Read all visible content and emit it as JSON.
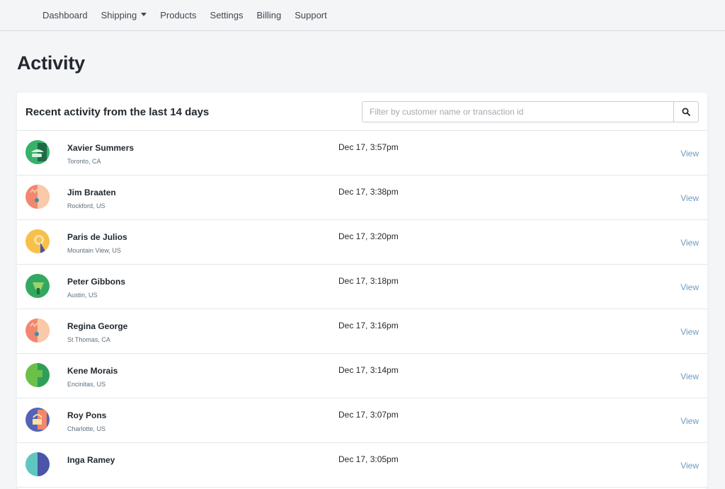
{
  "nav": {
    "items": [
      {
        "label": "Dashboard",
        "has_caret": false
      },
      {
        "label": "Shipping",
        "has_caret": true
      },
      {
        "label": "Products",
        "has_caret": false
      },
      {
        "label": "Settings",
        "has_caret": false
      },
      {
        "label": "Billing",
        "has_caret": false
      },
      {
        "label": "Support",
        "has_caret": false
      }
    ]
  },
  "page": {
    "title": "Activity"
  },
  "activity": {
    "heading": "Recent activity from the last 14 days",
    "search": {
      "placeholder": "Filter by customer name or transaction id",
      "value": "",
      "icon": "search-icon"
    },
    "view_label": "View",
    "rows": [
      {
        "name": "Xavier Summers",
        "location": "Toronto, CA",
        "time": "Dec 17, 3:57pm",
        "avatar": {
          "bg": "#38b26b",
          "fg": "#1f6b45",
          "accent": "#d6f2e1",
          "style": "a"
        }
      },
      {
        "name": "Jim Braaten",
        "location": "Rockford, US",
        "time": "Dec 17, 3:38pm",
        "avatar": {
          "bg": "#f2876f",
          "fg": "#f9c9a8",
          "accent": "#3a8fb0",
          "style": "b"
        }
      },
      {
        "name": "Paris de Julios",
        "location": "Mountain View, US",
        "time": "Dec 17, 3:20pm",
        "avatar": {
          "bg": "#f6c04b",
          "fg": "#fbe2a1",
          "accent": "#4a55a8",
          "style": "c"
        }
      },
      {
        "name": "Peter Gibbons",
        "location": "Austin, US",
        "time": "Dec 17, 3:18pm",
        "avatar": {
          "bg": "#33a860",
          "fg": "#9ad36a",
          "accent": "#1f6b45",
          "style": "d"
        }
      },
      {
        "name": "Regina George",
        "location": "St Thomas, CA",
        "time": "Dec 17, 3:16pm",
        "avatar": {
          "bg": "#f2876f",
          "fg": "#f9c9a8",
          "accent": "#3a8fb0",
          "style": "b"
        }
      },
      {
        "name": "Kene Morais",
        "location": "Encinitas, US",
        "time": "Dec 17, 3:14pm",
        "avatar": {
          "bg": "#6cc04a",
          "fg": "#2f9e5a",
          "accent": "#1f6b45",
          "style": "e"
        }
      },
      {
        "name": "Roy Pons",
        "location": "Charlotte, US",
        "time": "Dec 17, 3:07pm",
        "avatar": {
          "bg": "#5463b8",
          "fg": "#f2876f",
          "accent": "#fbe2a1",
          "style": "f"
        }
      },
      {
        "name": "Inga Ramey",
        "location": "",
        "time": "Dec 17, 3:05pm",
        "avatar": {
          "bg": "#5fc7c0",
          "fg": "#4a55a8",
          "accent": "#d6f2e1",
          "style": "g"
        }
      }
    ]
  }
}
